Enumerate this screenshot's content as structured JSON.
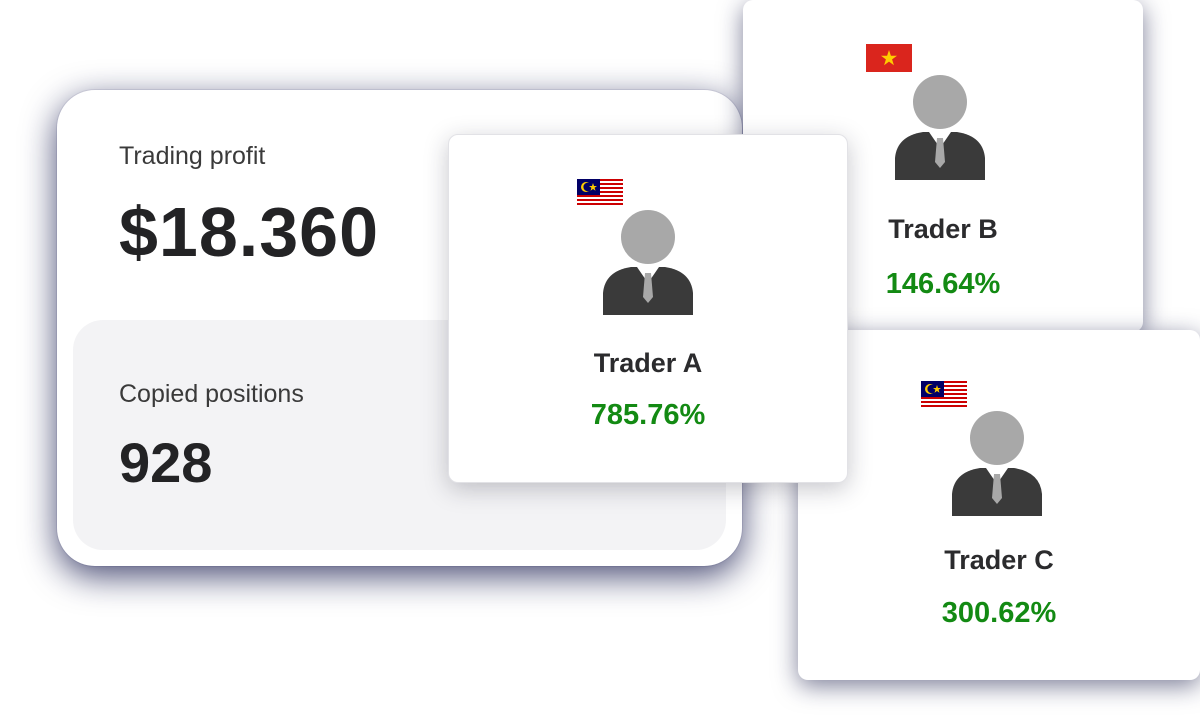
{
  "stats": {
    "profit_label": "Trading profit",
    "profit_value": "$18.360",
    "positions_label": "Copied positions",
    "positions_value": "928"
  },
  "traders": [
    {
      "name": "Trader A",
      "return": "785.76%",
      "flag": "malaysia-flag-icon"
    },
    {
      "name": "Trader B",
      "return": "146.64%",
      "flag": "vietnam-flag-icon"
    },
    {
      "name": "Trader C",
      "return": "300.62%",
      "flag": "malaysia-flag-icon"
    }
  ],
  "colors": {
    "return_green": "#138a13",
    "avatar_gray": "#a8a8a8",
    "suit_dark": "#3a3a3a",
    "panel_bg": "#f3f3f5"
  },
  "icons": {
    "avatar": "user-avatar-icon"
  }
}
